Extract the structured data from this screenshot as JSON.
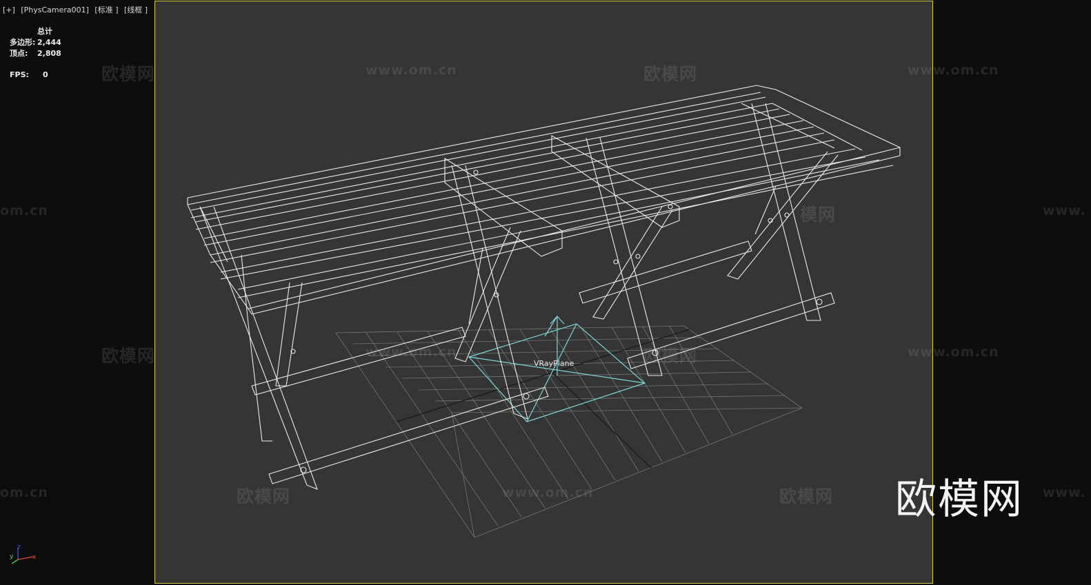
{
  "viewport": {
    "label_parts": [
      "[+]",
      "[PhysCamera001]",
      "[标准 ]",
      "[线框 ]"
    ]
  },
  "stats": {
    "header": "总计",
    "polygons_label": "多边形:",
    "polygons_value": "2,444",
    "vertices_label": "顶点:",
    "vertices_value": "2,808",
    "fps_label": "FPS:",
    "fps_value": "0"
  },
  "scene": {
    "object_label": "VRayPlane",
    "wireframe_color": "#ededed",
    "vrayplane_color": "#7fd6d6",
    "grid_color": "#8a8a8a",
    "safe_frame_color": "#d7d44a"
  },
  "watermarks": {
    "brand": "欧模网",
    "site": "www.om.cn",
    "site_partial_left": "om.cn",
    "site_partial_right": "www.",
    "brand_partial": "模网"
  },
  "axis_gizmo": {
    "x": "x",
    "y": "y",
    "z": "z"
  }
}
